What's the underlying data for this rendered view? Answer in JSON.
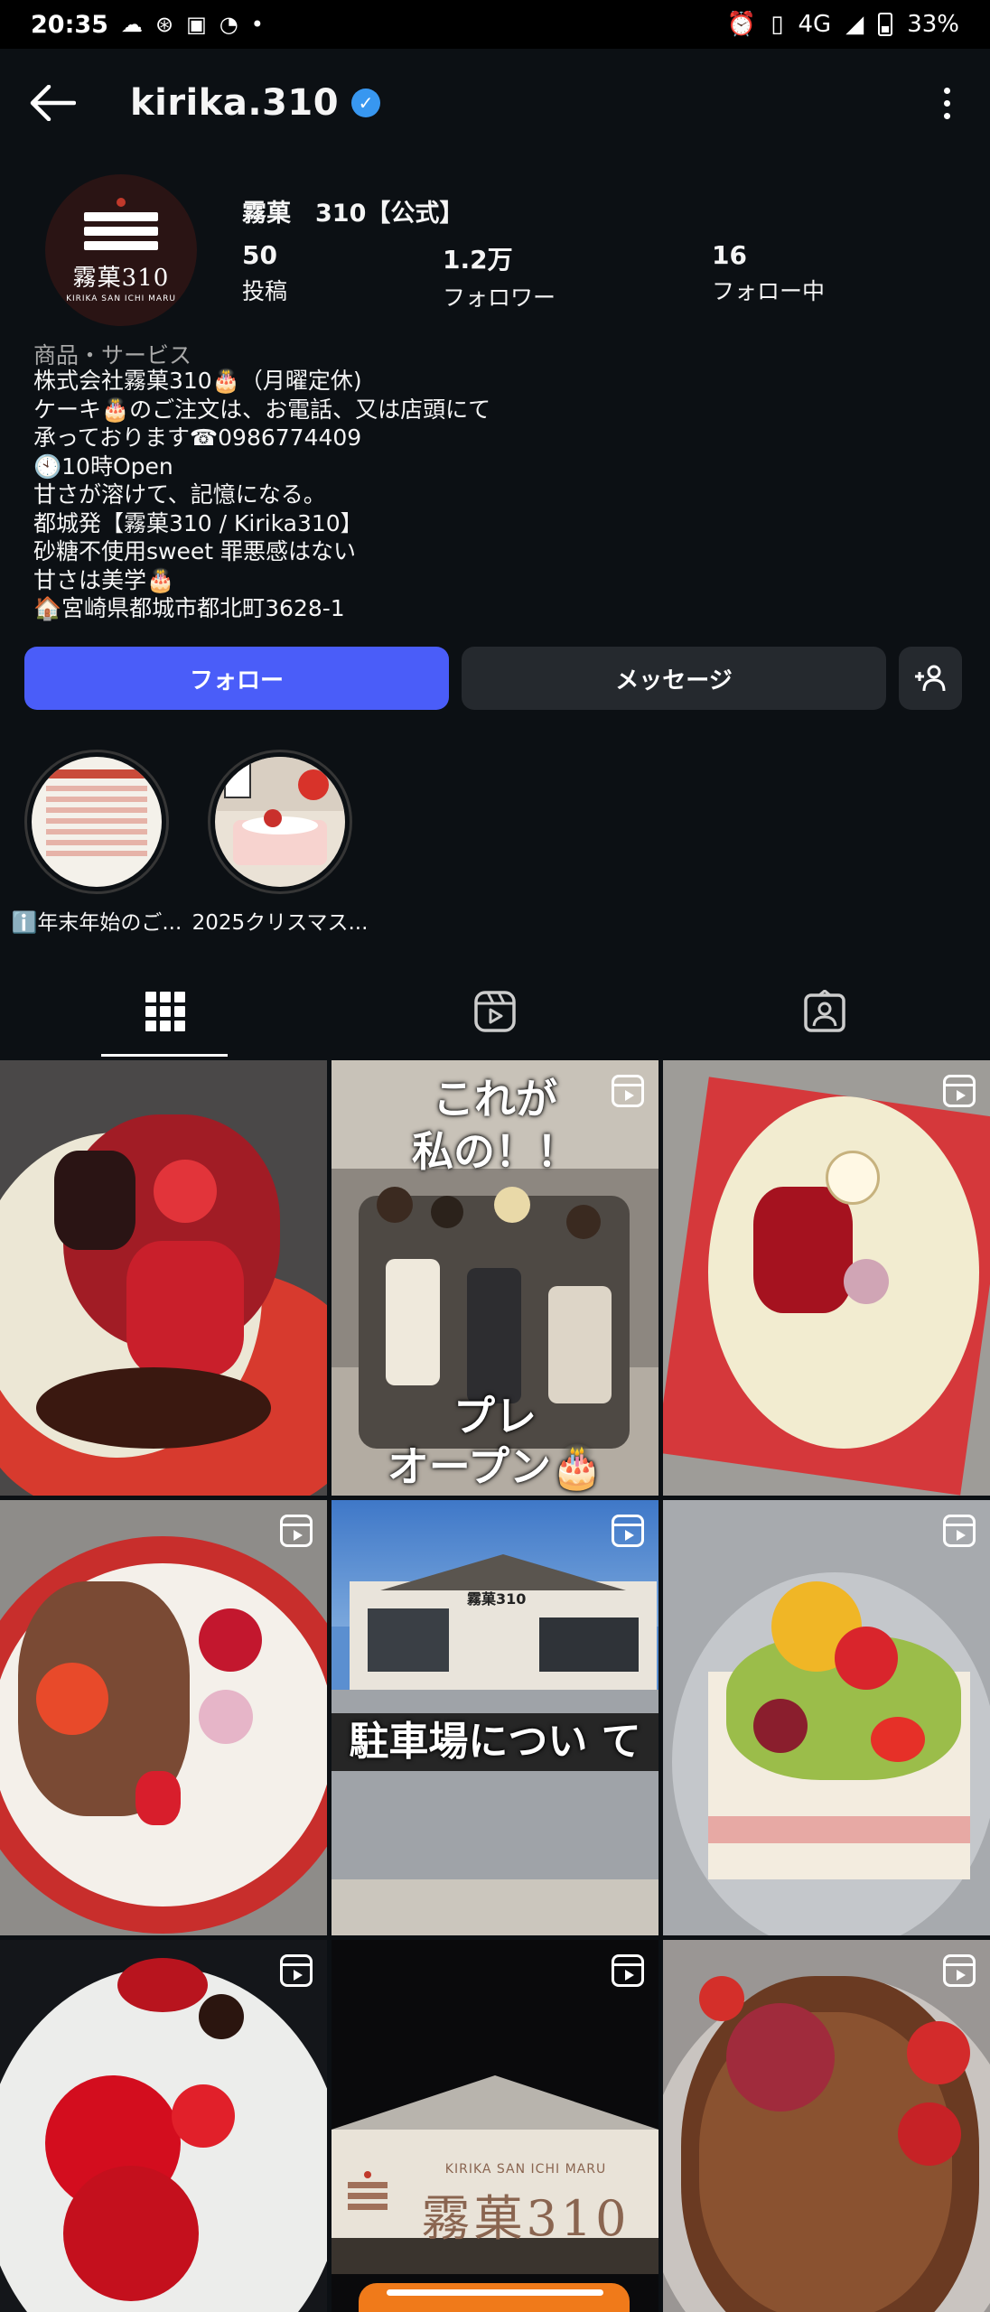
{
  "status_bar": {
    "time": "20:35",
    "network": "4G",
    "battery": "33%"
  },
  "header": {
    "username": "kirika.310",
    "verified": true
  },
  "profile": {
    "avatar": {
      "logo_text": "霧菓310",
      "logo_subtext": "KIRIKA SAN ICHI MARU"
    },
    "display_name": "霧菓　310【公式】",
    "stats": [
      {
        "value": "50",
        "label": "投稿"
      },
      {
        "value": "1.2万",
        "label": "フォロワー"
      },
      {
        "value": "16",
        "label": "フォロー中"
      }
    ],
    "category": "商品・サービス",
    "bio_lines": [
      "株式会社霧菓310🎂（月曜定休)",
      "ケーキ🎂のご注文は、お電話、又は店頭にて",
      "承っております☎0986774409",
      "🕙10時Open",
      "甘さが溶けて、記憶になる。",
      "都城発【霧菓310 / Kirika310】",
      "砂糖不使用sweet 罪悪感はない",
      "甘さは美学🎂",
      "🏠宮崎県都城市都北町3628-1"
    ]
  },
  "buttons": {
    "follow": "フォロー",
    "message": "メッセージ",
    "add_user": "+👤"
  },
  "highlights": [
    {
      "label": "ℹ️年末年始のご..."
    },
    {
      "label": "2025クリスマス..."
    }
  ],
  "grid_posts": [
    {
      "type": "image",
      "overlay": ""
    },
    {
      "type": "reel",
      "overlay_top": "これが\n私の！！",
      "overlay_bottom": "プレ\nオープン🎂"
    },
    {
      "type": "reel",
      "overlay": ""
    },
    {
      "type": "reel",
      "overlay": ""
    },
    {
      "type": "reel",
      "overlay_building": "霧菓310",
      "overlay_caption": "駐車場につい て"
    },
    {
      "type": "reel",
      "overlay": ""
    },
    {
      "type": "reel",
      "overlay": ""
    },
    {
      "type": "reel",
      "overlay_sign_small": "KIRIKA SAN ICHI MARU",
      "overlay_sign": "霧菓310"
    },
    {
      "type": "reel",
      "overlay": ""
    }
  ],
  "colors": {
    "background": "#0c1014",
    "follow_button": "#4a5df9",
    "secondary_button": "#25292e",
    "verified_badge": "#3897f0"
  }
}
